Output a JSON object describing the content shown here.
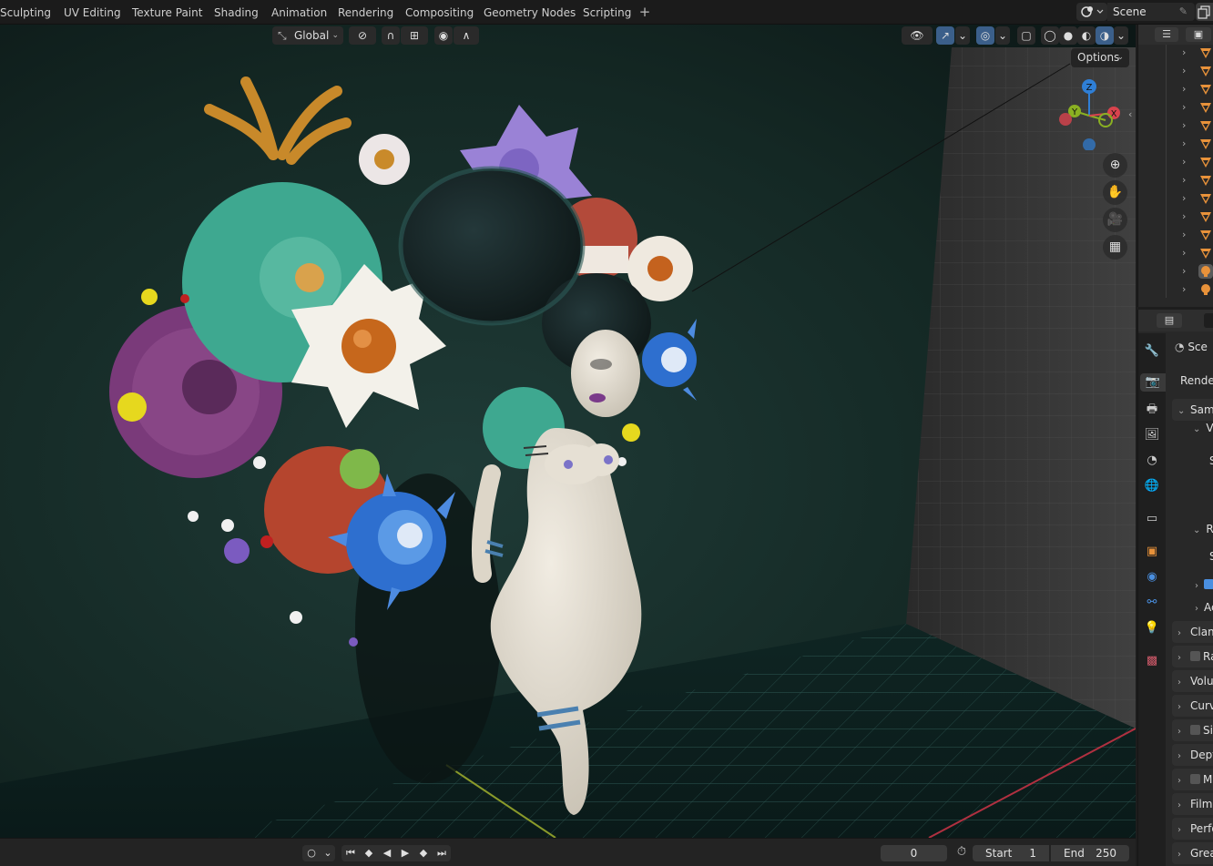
{
  "workspaces": [
    "Sculpting",
    "UV Editing",
    "Texture Paint",
    "Shading",
    "Animation",
    "Rendering",
    "Compositing",
    "Geometry Nodes",
    "Scripting"
  ],
  "workspace_add": "+",
  "scene": {
    "name": "Scene"
  },
  "viewport": {
    "orientation": "Global",
    "options": "Options",
    "gizmo_axes": {
      "z": "Z",
      "y": "Y",
      "x": "X"
    }
  },
  "outliner": {
    "rows": [
      "mesh",
      "mesh",
      "mesh",
      "mesh",
      "mesh",
      "mesh",
      "mesh",
      "mesh",
      "mesh",
      "mesh",
      "mesh",
      "mesh",
      "light",
      "light"
    ]
  },
  "properties": {
    "scene_label": "Sce",
    "render_engine": "Render",
    "sections": [
      "Samp",
      "Vi",
      "S",
      "Re",
      "S",
      "Ac",
      "Clam",
      "Ra",
      "Volu",
      "Curv",
      "Si",
      "Dept",
      "M",
      "Film",
      "Perfo",
      "Grea"
    ]
  },
  "timeline": {
    "current_frame": "0",
    "start_label": "Start",
    "start_value": "1",
    "end_label": "End",
    "end_value": "250"
  },
  "colors": {
    "accent": "#3b5f8a",
    "mesh_icon": "#e8923a",
    "axis_x": "#d9434d",
    "axis_y": "#8ab022",
    "axis_z": "#2f7fd6"
  }
}
